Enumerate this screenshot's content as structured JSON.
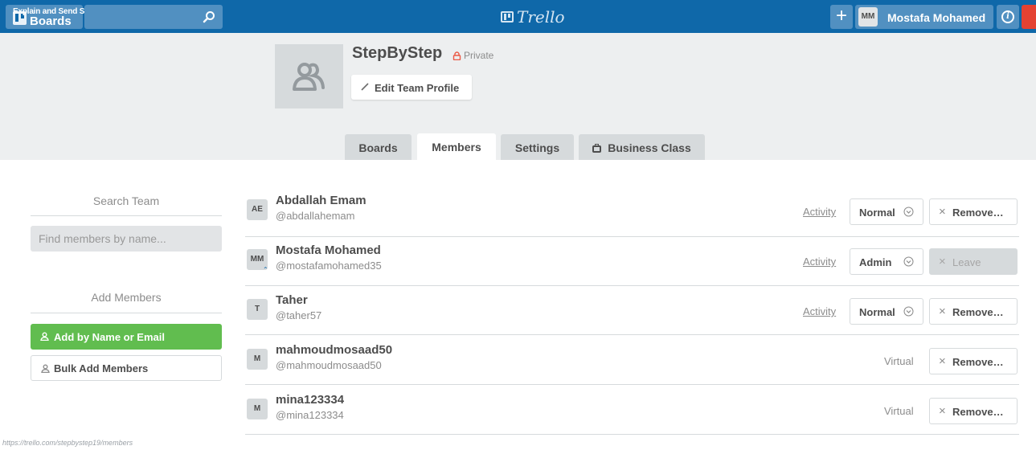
{
  "header": {
    "boards_label": "Boards",
    "overlay_label": "Explain and Send Screenshots",
    "logo_text": "Trello",
    "plus_label": "+",
    "user_initials": "MM",
    "user_name": "Mostafa Mohamed",
    "brand_color": "#0f68a9"
  },
  "team": {
    "name": "StepByStep",
    "visibility": "Private",
    "edit_label": "Edit Team Profile"
  },
  "tabs": [
    {
      "label": "Boards",
      "active": false
    },
    {
      "label": "Members",
      "active": true
    },
    {
      "label": "Settings",
      "active": false
    },
    {
      "label": "Business Class",
      "active": false
    }
  ],
  "sidebar": {
    "search_heading": "Search Team",
    "search_placeholder": "Find members by name...",
    "add_heading": "Add Members",
    "add_button": "Add by Name or Email",
    "bulk_button": "Bulk Add Members"
  },
  "members": [
    {
      "initials": "AE",
      "name": "Abdallah Emam",
      "handle": "@abdallahemam",
      "activity": "Activity",
      "role": "Normal",
      "action": "Remove…",
      "virtual": ""
    },
    {
      "initials": "MM",
      "name": "Mostafa Mohamed",
      "handle": "@mostafamohamed35",
      "activity": "Activity",
      "role": "Admin",
      "action": "Leave",
      "virtual": ""
    },
    {
      "initials": "T",
      "name": "Taher",
      "handle": "@taher57",
      "activity": "Activity",
      "role": "Normal",
      "action": "Remove…",
      "virtual": ""
    },
    {
      "initials": "M",
      "name": "mahmoudmosaad50",
      "handle": "@mahmoudmosaad50",
      "activity": "",
      "role": "",
      "action": "Remove…",
      "virtual": "Virtual"
    },
    {
      "initials": "M",
      "name": "mina123334",
      "handle": "@mina123334",
      "activity": "",
      "role": "",
      "action": "Remove…",
      "virtual": "Virtual"
    }
  ],
  "status_url": "https://trello.com/stepbystep19/members"
}
